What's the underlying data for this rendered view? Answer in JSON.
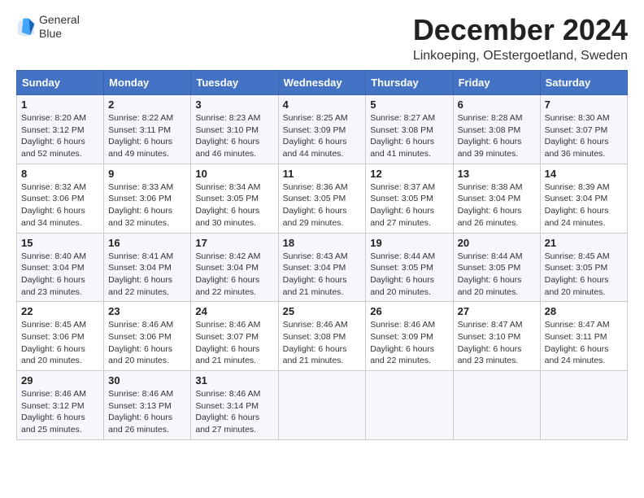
{
  "header": {
    "logo_line1": "General",
    "logo_line2": "Blue",
    "title": "December 2024",
    "subtitle": "Linkoeping, OEstergoetland, Sweden"
  },
  "weekdays": [
    "Sunday",
    "Monday",
    "Tuesday",
    "Wednesday",
    "Thursday",
    "Friday",
    "Saturday"
  ],
  "weeks": [
    [
      {
        "day": "1",
        "sunrise": "Sunrise: 8:20 AM",
        "sunset": "Sunset: 3:12 PM",
        "daylight": "Daylight: 6 hours and 52 minutes."
      },
      {
        "day": "2",
        "sunrise": "Sunrise: 8:22 AM",
        "sunset": "Sunset: 3:11 PM",
        "daylight": "Daylight: 6 hours and 49 minutes."
      },
      {
        "day": "3",
        "sunrise": "Sunrise: 8:23 AM",
        "sunset": "Sunset: 3:10 PM",
        "daylight": "Daylight: 6 hours and 46 minutes."
      },
      {
        "day": "4",
        "sunrise": "Sunrise: 8:25 AM",
        "sunset": "Sunset: 3:09 PM",
        "daylight": "Daylight: 6 hours and 44 minutes."
      },
      {
        "day": "5",
        "sunrise": "Sunrise: 8:27 AM",
        "sunset": "Sunset: 3:08 PM",
        "daylight": "Daylight: 6 hours and 41 minutes."
      },
      {
        "day": "6",
        "sunrise": "Sunrise: 8:28 AM",
        "sunset": "Sunset: 3:08 PM",
        "daylight": "Daylight: 6 hours and 39 minutes."
      },
      {
        "day": "7",
        "sunrise": "Sunrise: 8:30 AM",
        "sunset": "Sunset: 3:07 PM",
        "daylight": "Daylight: 6 hours and 36 minutes."
      }
    ],
    [
      {
        "day": "8",
        "sunrise": "Sunrise: 8:32 AM",
        "sunset": "Sunset: 3:06 PM",
        "daylight": "Daylight: 6 hours and 34 minutes."
      },
      {
        "day": "9",
        "sunrise": "Sunrise: 8:33 AM",
        "sunset": "Sunset: 3:06 PM",
        "daylight": "Daylight: 6 hours and 32 minutes."
      },
      {
        "day": "10",
        "sunrise": "Sunrise: 8:34 AM",
        "sunset": "Sunset: 3:05 PM",
        "daylight": "Daylight: 6 hours and 30 minutes."
      },
      {
        "day": "11",
        "sunrise": "Sunrise: 8:36 AM",
        "sunset": "Sunset: 3:05 PM",
        "daylight": "Daylight: 6 hours and 29 minutes."
      },
      {
        "day": "12",
        "sunrise": "Sunrise: 8:37 AM",
        "sunset": "Sunset: 3:05 PM",
        "daylight": "Daylight: 6 hours and 27 minutes."
      },
      {
        "day": "13",
        "sunrise": "Sunrise: 8:38 AM",
        "sunset": "Sunset: 3:04 PM",
        "daylight": "Daylight: 6 hours and 26 minutes."
      },
      {
        "day": "14",
        "sunrise": "Sunrise: 8:39 AM",
        "sunset": "Sunset: 3:04 PM",
        "daylight": "Daylight: 6 hours and 24 minutes."
      }
    ],
    [
      {
        "day": "15",
        "sunrise": "Sunrise: 8:40 AM",
        "sunset": "Sunset: 3:04 PM",
        "daylight": "Daylight: 6 hours and 23 minutes."
      },
      {
        "day": "16",
        "sunrise": "Sunrise: 8:41 AM",
        "sunset": "Sunset: 3:04 PM",
        "daylight": "Daylight: 6 hours and 22 minutes."
      },
      {
        "day": "17",
        "sunrise": "Sunrise: 8:42 AM",
        "sunset": "Sunset: 3:04 PM",
        "daylight": "Daylight: 6 hours and 22 minutes."
      },
      {
        "day": "18",
        "sunrise": "Sunrise: 8:43 AM",
        "sunset": "Sunset: 3:04 PM",
        "daylight": "Daylight: 6 hours and 21 minutes."
      },
      {
        "day": "19",
        "sunrise": "Sunrise: 8:44 AM",
        "sunset": "Sunset: 3:05 PM",
        "daylight": "Daylight: 6 hours and 20 minutes."
      },
      {
        "day": "20",
        "sunrise": "Sunrise: 8:44 AM",
        "sunset": "Sunset: 3:05 PM",
        "daylight": "Daylight: 6 hours and 20 minutes."
      },
      {
        "day": "21",
        "sunrise": "Sunrise: 8:45 AM",
        "sunset": "Sunset: 3:05 PM",
        "daylight": "Daylight: 6 hours and 20 minutes."
      }
    ],
    [
      {
        "day": "22",
        "sunrise": "Sunrise: 8:45 AM",
        "sunset": "Sunset: 3:06 PM",
        "daylight": "Daylight: 6 hours and 20 minutes."
      },
      {
        "day": "23",
        "sunrise": "Sunrise: 8:46 AM",
        "sunset": "Sunset: 3:06 PM",
        "daylight": "Daylight: 6 hours and 20 minutes."
      },
      {
        "day": "24",
        "sunrise": "Sunrise: 8:46 AM",
        "sunset": "Sunset: 3:07 PM",
        "daylight": "Daylight: 6 hours and 21 minutes."
      },
      {
        "day": "25",
        "sunrise": "Sunrise: 8:46 AM",
        "sunset": "Sunset: 3:08 PM",
        "daylight": "Daylight: 6 hours and 21 minutes."
      },
      {
        "day": "26",
        "sunrise": "Sunrise: 8:46 AM",
        "sunset": "Sunset: 3:09 PM",
        "daylight": "Daylight: 6 hours and 22 minutes."
      },
      {
        "day": "27",
        "sunrise": "Sunrise: 8:47 AM",
        "sunset": "Sunset: 3:10 PM",
        "daylight": "Daylight: 6 hours and 23 minutes."
      },
      {
        "day": "28",
        "sunrise": "Sunrise: 8:47 AM",
        "sunset": "Sunset: 3:11 PM",
        "daylight": "Daylight: 6 hours and 24 minutes."
      }
    ],
    [
      {
        "day": "29",
        "sunrise": "Sunrise: 8:46 AM",
        "sunset": "Sunset: 3:12 PM",
        "daylight": "Daylight: 6 hours and 25 minutes."
      },
      {
        "day": "30",
        "sunrise": "Sunrise: 8:46 AM",
        "sunset": "Sunset: 3:13 PM",
        "daylight": "Daylight: 6 hours and 26 minutes."
      },
      {
        "day": "31",
        "sunrise": "Sunrise: 8:46 AM",
        "sunset": "Sunset: 3:14 PM",
        "daylight": "Daylight: 6 hours and 27 minutes."
      },
      null,
      null,
      null,
      null
    ]
  ]
}
